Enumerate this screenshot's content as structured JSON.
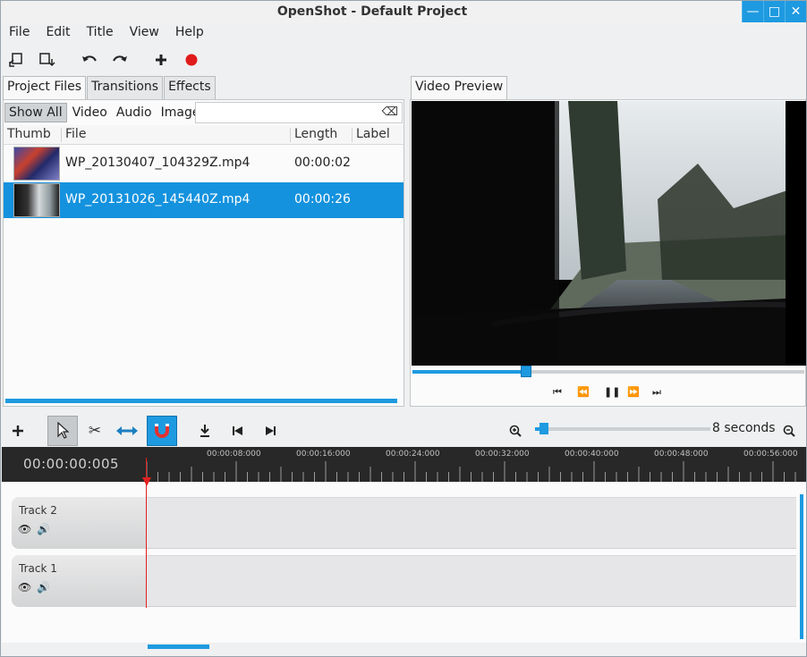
{
  "window": {
    "title": "OpenShot - Default Project"
  },
  "menu": [
    "File",
    "Edit",
    "Title",
    "View",
    "Help"
  ],
  "project_tabs": [
    "Project Files",
    "Transitions",
    "Effects"
  ],
  "filters": [
    "Show All",
    "Video",
    "Audio",
    "Image"
  ],
  "columns": [
    "Thumb",
    "File",
    "Length",
    "Label"
  ],
  "files": [
    {
      "name": "WP_20130407_104329Z.mp4",
      "length": "00:00:02",
      "label": ""
    },
    {
      "name": "WP_20131026_145440Z.mp4",
      "length": "00:00:26",
      "label": ""
    }
  ],
  "preview": {
    "tab": "Video Preview",
    "progress": 0.29
  },
  "timeline": {
    "timecode": "00:00:00:005",
    "zoom_label": "8 seconds",
    "ruler_labels": [
      "00:00:08:000",
      "00:00:16:000",
      "00:00:24:000",
      "00:00:32:000",
      "00:00:40:000",
      "00:00:48:000",
      "00:00:56:000"
    ],
    "tracks": [
      "Track 2",
      "Track 1"
    ]
  },
  "colors": {
    "accent": "#1e9ae0",
    "playhead": "#e02020",
    "ruler_bg": "#282828"
  }
}
